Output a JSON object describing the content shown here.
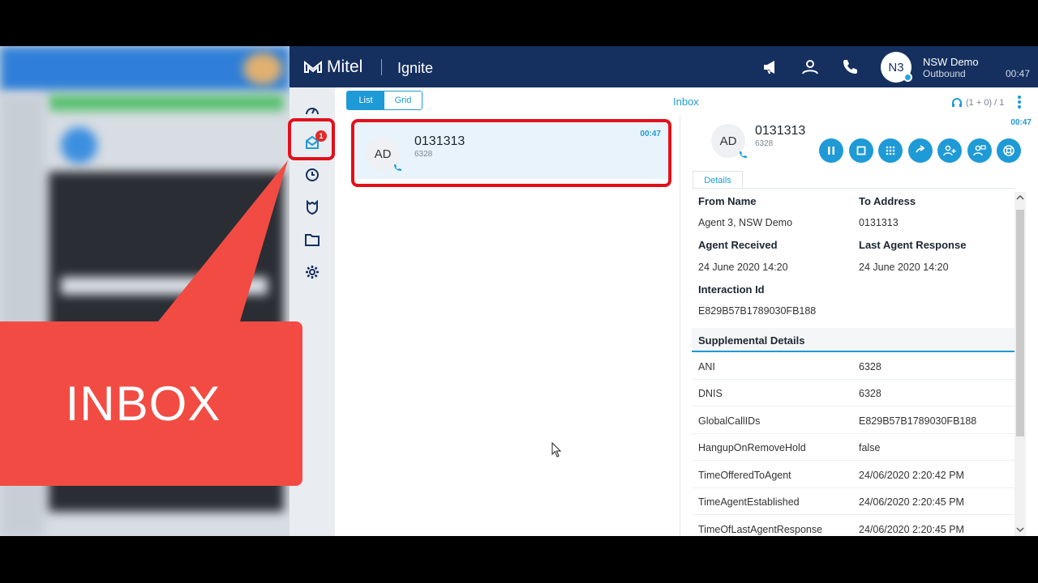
{
  "app": {
    "brand": "Mitel",
    "name": "Ignite"
  },
  "user": {
    "initials": "N3",
    "name": "NSW Demo",
    "status": "Outbound",
    "time": "00:47"
  },
  "nav": {
    "inbox_badge": "1"
  },
  "toolbar": {
    "list_label": "List",
    "grid_label": "Grid",
    "title": "Inbox",
    "counter": "(1 + 0) / 1"
  },
  "list": {
    "items": [
      {
        "initials": "AD",
        "title": "0131313",
        "sub": "6328",
        "time": "00:47"
      }
    ]
  },
  "detail": {
    "initials": "AD",
    "title": "0131313",
    "sub": "6328",
    "time": "00:47",
    "tab": "Details",
    "fields": {
      "from_name_label": "From Name",
      "from_name": "Agent 3, NSW Demo",
      "to_address_label": "To Address",
      "to_address": "0131313",
      "agent_received_label": "Agent Received",
      "agent_received": "24 June 2020 14:20",
      "last_response_label": "Last Agent Response",
      "last_response": "24 June 2020 14:20",
      "interaction_id_label": "Interaction Id",
      "interaction_id": "E829B57B1789030FB188"
    },
    "supplemental_title": "Supplemental Details",
    "supplemental": [
      {
        "key": "ANI",
        "value": "6328"
      },
      {
        "key": "DNIS",
        "value": "6328"
      },
      {
        "key": "GlobalCallIDs",
        "value": "E829B57B1789030FB188"
      },
      {
        "key": "HangupOnRemoveHold",
        "value": "false"
      },
      {
        "key": "TimeOfferedToAgent",
        "value": "24/06/2020 2:20:42 PM"
      },
      {
        "key": "TimeAgentEstablished",
        "value": "24/06/2020 2:20:45 PM"
      },
      {
        "key": "TimeOfLastAgentResponse",
        "value": "24/06/2020 2:20:45 PM"
      }
    ]
  },
  "callout": {
    "text": "INBOX"
  },
  "colors": {
    "topbar": "#15305f",
    "accent": "#1e9ad6",
    "highlight": "#e3101a",
    "callout": "#f24b43"
  }
}
